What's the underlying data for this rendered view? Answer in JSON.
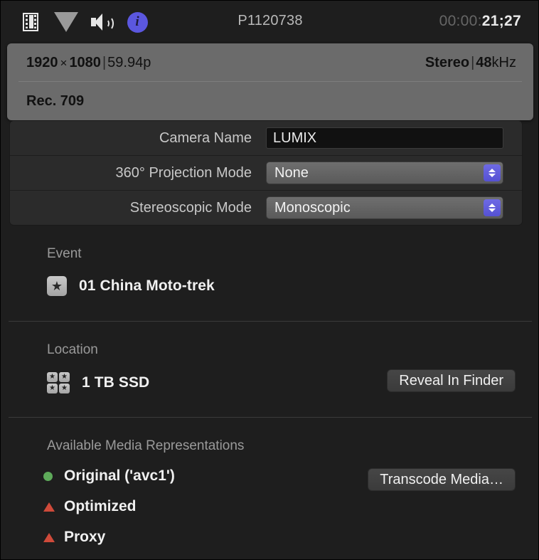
{
  "topbar": {
    "icons": [
      {
        "name": "filmstrip-icon",
        "label": "Video"
      },
      {
        "name": "video-triangle-icon",
        "label": "Video Inspector"
      },
      {
        "name": "speaker-icon",
        "label": "Audio"
      },
      {
        "name": "info-icon",
        "label": "Info"
      }
    ],
    "clip_title": "P1120738",
    "timecode_dim": "00:00:",
    "timecode_lit": "21;27"
  },
  "tooltip": {
    "row1": {
      "width": "1920",
      "x_symbol": "×",
      "height": "1080",
      "separator": "|",
      "framerate": "59.94p",
      "audio_channels": "Stereo",
      "audio_separator": "|",
      "audio_rate_num": "48",
      "audio_rate_unit": "kHz"
    },
    "row2": {
      "colorspace": "Rec. 709"
    }
  },
  "form": {
    "rows": [
      {
        "label": "Camera Name",
        "type": "text",
        "value": "LUMIX"
      },
      {
        "label": "360° Projection Mode",
        "type": "popup",
        "value": "None"
      },
      {
        "label": "Stereoscopic Mode",
        "type": "popup",
        "value": "Monoscopic"
      }
    ]
  },
  "event": {
    "title": "Event",
    "icon": "star-icon",
    "star_glyph": "★",
    "name": "01 China Moto-trek"
  },
  "location": {
    "title": "Location",
    "icon": "library-icon",
    "star_glyph": "★",
    "name": "1 TB SSD",
    "reveal_button": "Reveal In Finder"
  },
  "media": {
    "title": "Available Media Representations",
    "transcode_button": "Transcode Media…",
    "items": [
      {
        "label": "Original ('avc1')",
        "status": "available",
        "marker": "dot",
        "color": "#5eaa5a"
      },
      {
        "label": "Optimized",
        "status": "missing",
        "marker": "triangle",
        "color": "#cf4a3a"
      },
      {
        "label": "Proxy",
        "status": "missing",
        "marker": "triangle",
        "color": "#cf4a3a"
      }
    ]
  },
  "colors": {
    "background": "#1e1e1e",
    "tooltip_bg": "#6b6b6b",
    "accent_blue": "#5b57df",
    "stepper_blue": "#5551d3",
    "available_green": "#5eaa5a",
    "missing_red": "#cf4a3a"
  }
}
